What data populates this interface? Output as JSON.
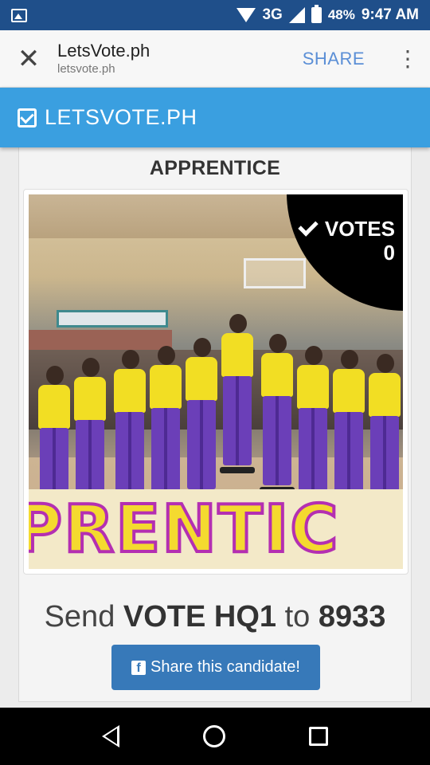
{
  "status_bar": {
    "network": "3G",
    "battery": "48%",
    "time": "9:47 AM",
    "icons": [
      "image-icon",
      "wifi-icon",
      "signal-icon",
      "battery-icon"
    ]
  },
  "browser": {
    "close_icon": "✕",
    "title": "LetsVote.ph",
    "url": "letsvote.ph",
    "share_label": "SHARE",
    "menu_icon": "⋮"
  },
  "site": {
    "title": "LETSVOTE.PH",
    "accent_color": "#3a9fe0"
  },
  "candidate": {
    "name": "APPRENTICE",
    "votes_label": "VOTES",
    "votes_count": "0",
    "banner_text": "PRENTIC",
    "cta_prefix": "Send ",
    "cta_keyword": "VOTE HQ1",
    "cta_mid": " to ",
    "cta_number": "8933",
    "share_button_label": "Share this candidate!",
    "share_button_color": "#3779b9"
  },
  "nav": {
    "icons": [
      "back-icon",
      "home-icon",
      "recents-icon"
    ]
  }
}
